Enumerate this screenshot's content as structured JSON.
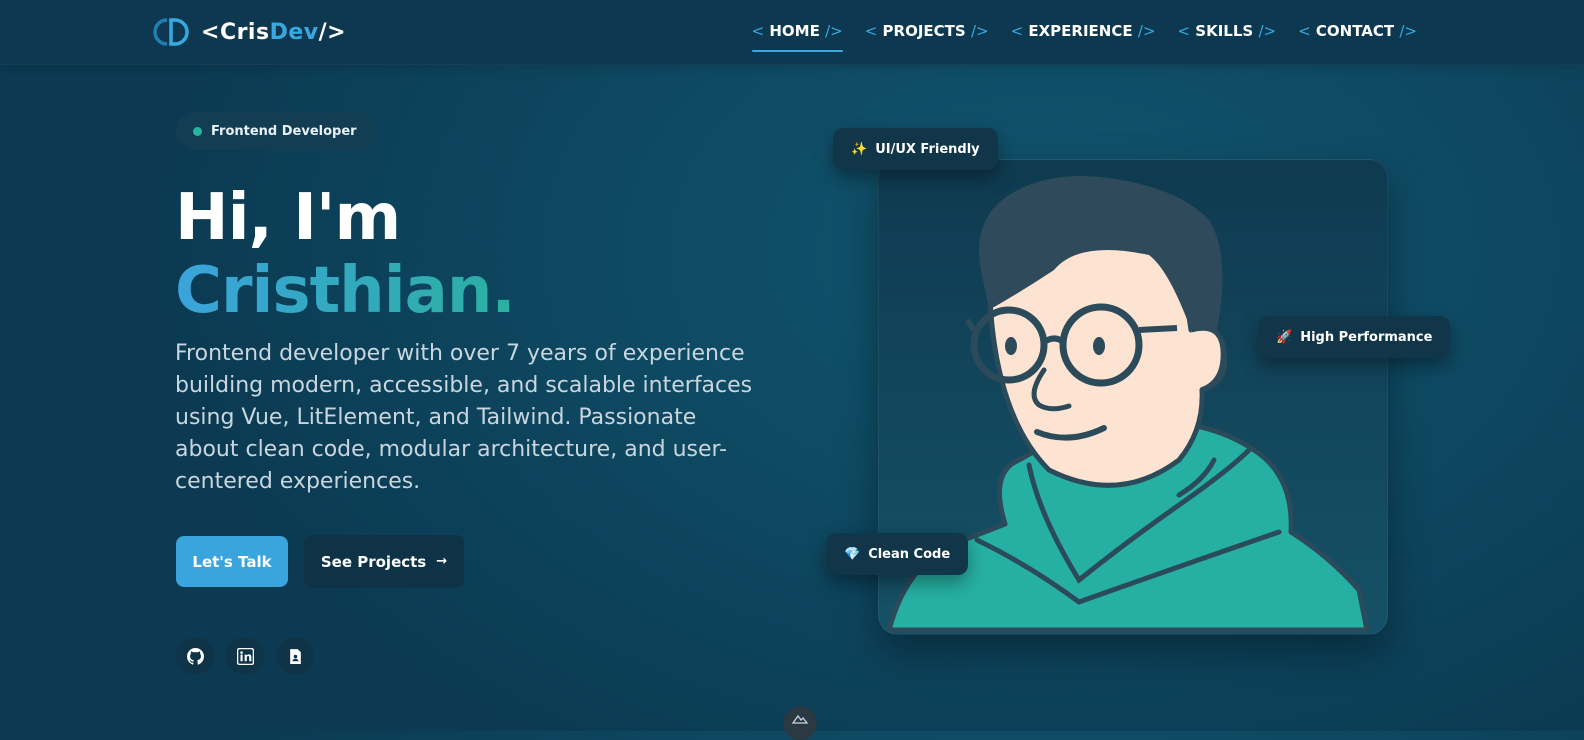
{
  "colors": {
    "accent": "#38a9e0",
    "teal": "#26b5a0",
    "bg": "#0e4a63",
    "header": "#0d3850"
  },
  "logo": {
    "prefix": "<",
    "cris": "Cris",
    "dev": "Dev",
    "suffix": "/>"
  },
  "nav": {
    "open": "<",
    "close": "/>",
    "items": [
      {
        "label": "HOME",
        "active": true
      },
      {
        "label": "PROJECTS",
        "active": false
      },
      {
        "label": "EXPERIENCE",
        "active": false
      },
      {
        "label": "SKILLS",
        "active": false
      },
      {
        "label": "CONTACT",
        "active": false
      }
    ]
  },
  "hero": {
    "badge": "Frontend Developer",
    "greeting": "Hi, I'm",
    "name": "Cristhian.",
    "description": "Frontend developer with over 7 years of experience building modern, accessible, and scalable interfaces using Vue, LitElement, and Tailwind. Passionate about clean code, modular architecture, and user-centered experiences.",
    "primary_button": "Let's Talk",
    "secondary_button": "See Projects",
    "secondary_button_icon": "→",
    "socials": [
      {
        "icon": "github-icon"
      },
      {
        "icon": "linkedin-icon"
      },
      {
        "icon": "resume-icon"
      }
    ]
  },
  "chips": [
    {
      "icon": "sparkles-icon",
      "glyph": "✨",
      "label": "UI/UX Friendly"
    },
    {
      "icon": "rocket-icon",
      "glyph": "🚀",
      "label": "High Performance"
    },
    {
      "icon": "diamond-icon",
      "glyph": "💎",
      "label": "Clean Code"
    }
  ]
}
